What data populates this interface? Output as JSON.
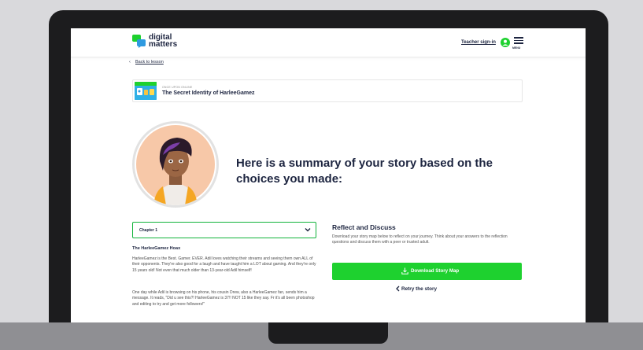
{
  "header": {
    "logo_line1": "digital",
    "logo_line2": "matters",
    "teacher_link": "Teacher sign-in",
    "menu_label": "MENU"
  },
  "back_link": "Back to lesson",
  "lesson": {
    "kicker": "ONCE UPON ONLINE",
    "title": "The Secret Identity of HarleeGamez"
  },
  "summary_title": "Here is a summary of your story based on the choices you made:",
  "chapter_select": {
    "value": "Chapter 1"
  },
  "story": {
    "heading": "The HarleeGamez Hoax",
    "paragraphs": [
      "HarleeGamez is the Best. Gamer. EVER. Adil loves watching their streams and seeing them own ALL of their opponents. They're also good for a laugh and have taught him a LOT about gaming. And they're only 15 years old! Not even that much older than 13-year-old Adil himself!",
      "One day while Adil is browsing on his phone, his cousin Drew, also a HarleeGamez fan, sends him a message. It reads, \"Did u see this?! HarleeGamez is 37!! NOT 15 like they say. Fr it's all been photoshop and editing to try and get more followers!\""
    ]
  },
  "reflect": {
    "title": "Reflect and Discuss",
    "body": "Download your story map below to reflect on your journey. Think about your answers to the reflection questions and discuss them with a peer or trusted adult.",
    "download_label": "Download Story Map",
    "retry_label": "Retry the story"
  },
  "colors": {
    "brand_green": "#1ed12f",
    "navy": "#1d2540",
    "select_border": "#12b33b"
  }
}
